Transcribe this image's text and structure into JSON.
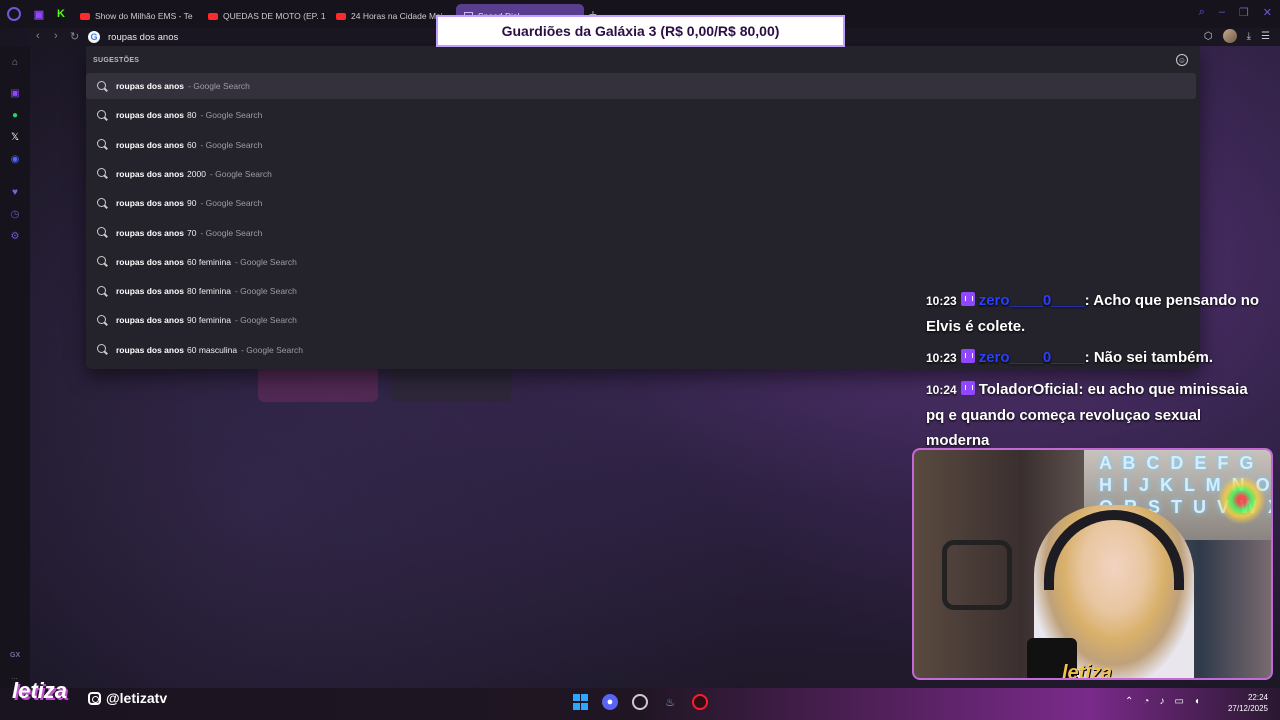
{
  "tabs": [
    {
      "label": "Show do Milhão EMS - Te",
      "icon": "youtube-icon"
    },
    {
      "label": "QUEDAS DE MOTO (EP. 1",
      "icon": "youtube-icon"
    },
    {
      "label": "24 Horas na Cidade Mai",
      "icon": "youtube-icon"
    },
    {
      "label": "Speed Dial",
      "icon": "speed-dial-icon",
      "active": true
    }
  ],
  "address_bar": {
    "value": "roupas dos anos"
  },
  "suggestions": {
    "header": "SUGESTÕES",
    "source_label": "- Google Search",
    "items": [
      {
        "bold": "roupas dos anos",
        "rest": "",
        "source": "- Google Search"
      },
      {
        "bold": "roupas dos anos",
        "rest": "80",
        "source": "- Google Search"
      },
      {
        "bold": "roupas dos anos",
        "rest": "60",
        "source": "- Google Search"
      },
      {
        "bold": "roupas dos anos",
        "rest": "2000",
        "source": "- Google Search"
      },
      {
        "bold": "roupas dos anos",
        "rest": "90",
        "source": "- Google Search"
      },
      {
        "bold": "roupas dos anos",
        "rest": "70",
        "source": "- Google Search"
      },
      {
        "bold": "roupas dos anos",
        "rest": "60 feminina",
        "source": "- Google Search"
      },
      {
        "bold": "roupas dos anos",
        "rest": "80 feminina",
        "source": "- Google Search"
      },
      {
        "bold": "roupas dos anos",
        "rest": "90 feminina",
        "source": "- Google Search"
      },
      {
        "bold": "roupas dos anos",
        "rest": "60 masculina",
        "source": "- Google Search"
      }
    ]
  },
  "banner": {
    "text": "Guardiões da Galáxia 3 (R$ 0,00/R$ 80,00)"
  },
  "chat": {
    "messages": [
      {
        "time": "10:23",
        "user": "zero____0____",
        "text": "Acho que pensando no Elvis é colete."
      },
      {
        "time": "10:23",
        "user": "zero____0____",
        "text": "Não sei também."
      },
      {
        "time": "10:24",
        "user": "ToladorOficial",
        "text": ": eu acho que minissaia pq e quando começa revoluçao sexual moderna"
      }
    ]
  },
  "webcam": {
    "sign_text": "A B C D E F G\nH I J K L M N O P\nQ R S T U V W X Y Z",
    "logo": "letiza"
  },
  "stream_overlay": {
    "brand": "letiza",
    "handle": "@letizatv"
  },
  "sidebar": {
    "gx_label": "GX",
    "more": "..."
  },
  "clock": {
    "time": "22:24",
    "date": "27/12/2025"
  },
  "colors": {
    "accent": "#9146ff",
    "opera": "#6b5bd6",
    "tab_active": "#5b3d8f",
    "chat_user_blue": "#2b3fff"
  }
}
